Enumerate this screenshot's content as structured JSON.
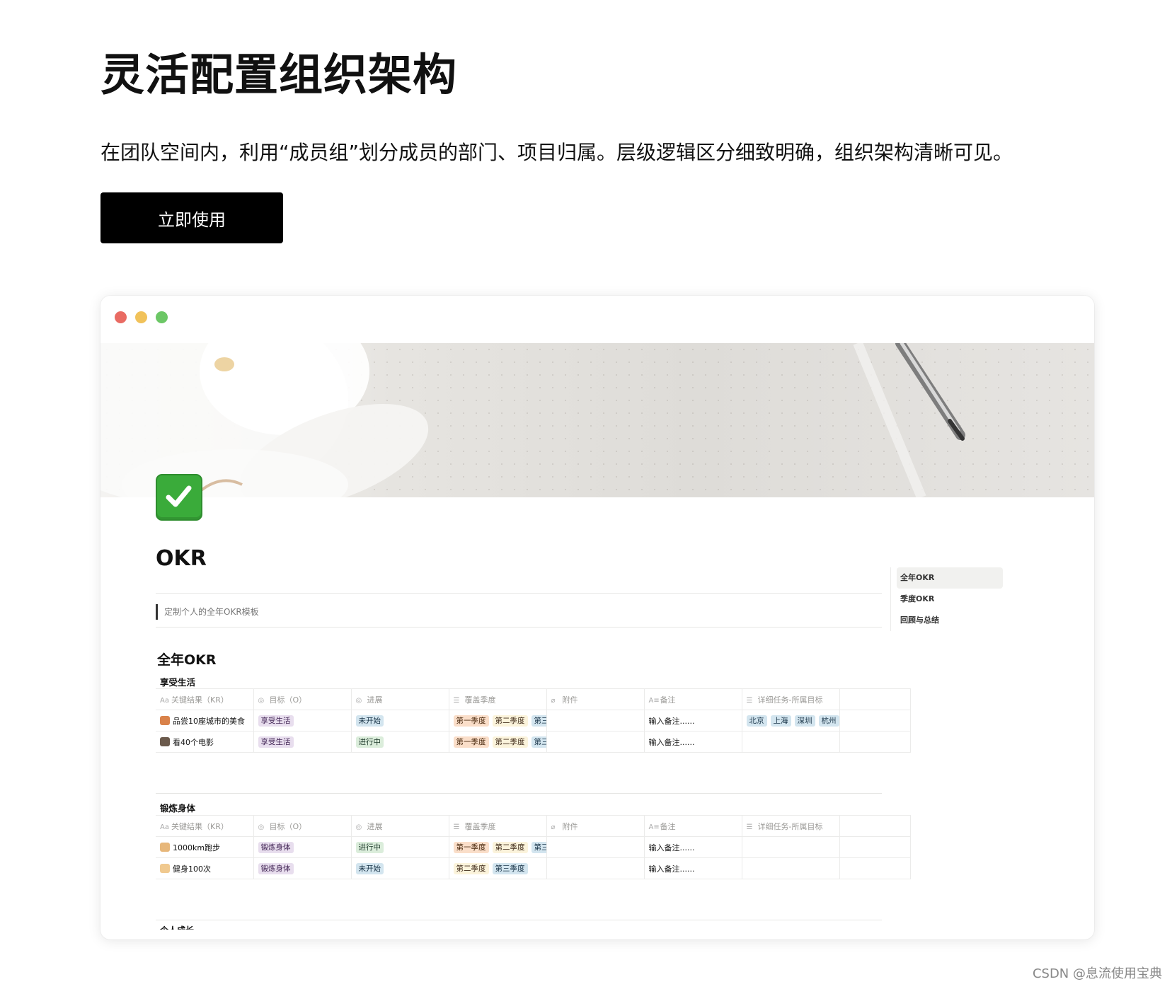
{
  "hero": {
    "title": "灵活配置组织架构",
    "description": "在团队空间内，利用“成员组”划分成员的部门、项目归属。层级逻辑区分细致明确，组织架构清晰可见。",
    "cta_label": "立即使用"
  },
  "page": {
    "title": "OKR",
    "quote": "定制个人的全年OKR模板",
    "section_title": "全年OKR",
    "next_section_partial": "个人成长"
  },
  "columns": [
    {
      "icon": "Aa",
      "label": "关键结果（KR）"
    },
    {
      "icon": "◎",
      "label": "目标（O）"
    },
    {
      "icon": "◎",
      "label": "进展"
    },
    {
      "icon": "☰",
      "label": "覆盖季度"
    },
    {
      "icon": "⌀",
      "label": "附件"
    },
    {
      "icon": "A≡",
      "label": "备注"
    },
    {
      "icon": "☰",
      "label": "详细任务-所属目标"
    }
  ],
  "groups": [
    {
      "title": "享受生活",
      "rows": [
        {
          "icon": "bread-icon",
          "kr": "品尝10座城市的美食",
          "objective": "享受生活",
          "status": "未开始",
          "status_color": "blue",
          "quarters": [
            "第一季度",
            "第二季度",
            "第三季度"
          ],
          "note": "输入备注......",
          "tasks": [
            "北京",
            "上海",
            "深圳",
            "杭州"
          ]
        },
        {
          "icon": "film-icon",
          "kr": "看40个电影",
          "objective": "享受生活",
          "status": "进行中",
          "status_color": "green",
          "quarters": [
            "第一季度",
            "第二季度",
            "第三季度"
          ],
          "note": "输入备注......",
          "tasks": []
        }
      ]
    },
    {
      "title": "锻炼身体",
      "rows": [
        {
          "icon": "runner-icon",
          "kr": "1000km跑步",
          "objective": "锻炼身体",
          "status": "进行中",
          "status_color": "green",
          "quarters": [
            "第一季度",
            "第二季度",
            "第三季度"
          ],
          "note": "输入备注......",
          "tasks": []
        },
        {
          "icon": "muscle-icon",
          "kr": "健身100次",
          "objective": "锻炼身体",
          "status": "未开始",
          "status_color": "blue",
          "quarters": [
            "第二季度",
            "第三季度"
          ],
          "note": "输入备注......",
          "tasks": []
        }
      ]
    }
  ],
  "toc": [
    "全年OKR",
    "季度OKR",
    "回顾与总结"
  ],
  "watermark": "CSDN @息流使用宝典",
  "colors": {
    "red_dot": "#e96b63",
    "yellow_dot": "#f1c25a",
    "green_dot": "#6cc766",
    "cta_bg": "#000000"
  }
}
